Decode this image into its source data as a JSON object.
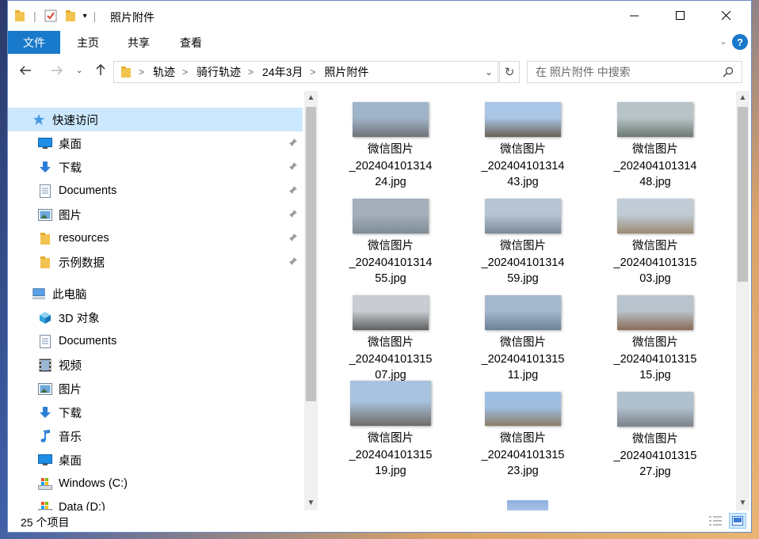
{
  "window": {
    "title": "照片附件"
  },
  "ribbon": {
    "tabs": [
      "文件",
      "主页",
      "共享",
      "查看"
    ],
    "help": "?"
  },
  "address": {
    "crumbs": [
      "轨迹",
      "骑行轨迹",
      "24年3月",
      "照片附件"
    ]
  },
  "search": {
    "placeholder": "在 照片附件 中搜索"
  },
  "nav": {
    "items": [
      {
        "label": "快速访问",
        "icon": "star-icon",
        "pinned": false
      },
      {
        "label": "桌面",
        "icon": "desktop-icon",
        "pinned": true
      },
      {
        "label": "下载",
        "icon": "download-icon",
        "pinned": true
      },
      {
        "label": "Documents",
        "icon": "document-icon",
        "pinned": true
      },
      {
        "label": "图片",
        "icon": "pictures-icon",
        "pinned": true
      },
      {
        "label": "resources",
        "icon": "folder-icon",
        "pinned": true
      },
      {
        "label": "示例数据",
        "icon": "folder-icon",
        "pinned": true
      },
      {
        "label": "此电脑",
        "icon": "computer-icon",
        "pinned": false
      },
      {
        "label": "3D 对象",
        "icon": "3d-objects-icon",
        "pinned": false
      },
      {
        "label": "Documents",
        "icon": "document-icon",
        "pinned": false
      },
      {
        "label": "视频",
        "icon": "video-icon",
        "pinned": false
      },
      {
        "label": "图片",
        "icon": "pictures-icon",
        "pinned": false
      },
      {
        "label": "下载",
        "icon": "download-icon",
        "pinned": false
      },
      {
        "label": "音乐",
        "icon": "music-icon",
        "pinned": false
      },
      {
        "label": "桌面",
        "icon": "desktop-icon",
        "pinned": false
      },
      {
        "label": "Windows (C:)",
        "icon": "drive-icon",
        "pinned": false
      },
      {
        "label": "Data (D:)",
        "icon": "drive-icon",
        "pinned": false
      }
    ]
  },
  "files": [
    {
      "l1": "微信图片",
      "l2": "_202404101314",
      "l3": "24.jpg",
      "colors": [
        "#9fb4c8",
        "#6f7378"
      ]
    },
    {
      "l1": "微信图片",
      "l2": "_202404101314",
      "l3": "43.jpg",
      "colors": [
        "#a9c6e6",
        "#6b6155"
      ]
    },
    {
      "l1": "微信图片",
      "l2": "_202404101314",
      "l3": "48.jpg",
      "colors": [
        "#b8c3c8",
        "#6c7a70"
      ]
    },
    {
      "l1": "微信图片",
      "l2": "_202404101314",
      "l3": "55.jpg",
      "colors": [
        "#a4afbb",
        "#7f8c95"
      ]
    },
    {
      "l1": "微信图片",
      "l2": "_202404101314",
      "l3": "59.jpg",
      "colors": [
        "#b7c4d2",
        "#7b8a97"
      ]
    },
    {
      "l1": "微信图片",
      "l2": "_202404101315",
      "l3": "03.jpg",
      "colors": [
        "#c1ccd6",
        "#9a8a74"
      ]
    },
    {
      "l1": "微信图片",
      "l2": "_202404101315",
      "l3": "07.jpg",
      "colors": [
        "#c9cdd3",
        "#5e6060"
      ]
    },
    {
      "l1": "微信图片",
      "l2": "_202404101315",
      "l3": "11.jpg",
      "colors": [
        "#a6b8cc",
        "#6d8196"
      ]
    },
    {
      "l1": "微信图片",
      "l2": "_202404101315",
      "l3": "15.jpg",
      "colors": [
        "#b9c3cd",
        "#8a6a55"
      ]
    },
    {
      "l1": "微信图片",
      "l2": "_202404101315",
      "l3": "19.jpg",
      "colors": [
        "#a9c2df",
        "#6e6d66"
      ]
    },
    {
      "l1": "微信图片",
      "l2": "_202404101315",
      "l3": "23.jpg",
      "colors": [
        "#9fbfe2",
        "#8a7c66"
      ]
    },
    {
      "l1": "微信图片",
      "l2": "_202404101315",
      "l3": "27.jpg",
      "colors": [
        "#b0c0cf",
        "#7c8187"
      ]
    }
  ],
  "status": {
    "count": "25 个项目"
  }
}
